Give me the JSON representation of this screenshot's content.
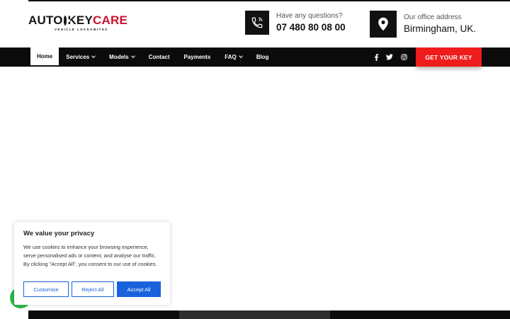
{
  "header": {
    "logo": {
      "part1": "AUTO",
      "part2": "KEY",
      "part3": "CARE",
      "tagline": "VEHICLE LOCKSMITHS"
    },
    "phone": {
      "label": "Have any questions?",
      "value": "07 480 80 08 00",
      "icon": "phone-icon"
    },
    "office": {
      "label": "Our office address",
      "value": "Birmingham, UK.",
      "icon": "location-pin-icon"
    }
  },
  "nav": {
    "items": [
      {
        "label": "Home",
        "active": true
      },
      {
        "label": "Services",
        "dropdown": true
      },
      {
        "label": "Models",
        "dropdown": true
      },
      {
        "label": "Contact"
      },
      {
        "label": "Payments"
      },
      {
        "label": "FAQ",
        "dropdown": true
      },
      {
        "label": "Blog"
      }
    ],
    "social": [
      "facebook-icon",
      "twitter-icon",
      "instagram-icon"
    ],
    "cta_label": "GET YOUR KEY"
  },
  "cookie": {
    "title": "We value your privacy",
    "text": "We use cookies to enhance your browsing experience, serve personalised ads or content, and analyse our traffic. By clicking \"Accept All\", you consent to our use of cookies.",
    "buttons": {
      "customise": "Customise",
      "reject": "Reject All",
      "accept": "Accept All"
    }
  },
  "colors": {
    "accent_red": "#ef1c1c",
    "logo_red": "#c8102e",
    "cookie_blue": "#1863dc",
    "whatsapp_green": "#2fb84a"
  }
}
